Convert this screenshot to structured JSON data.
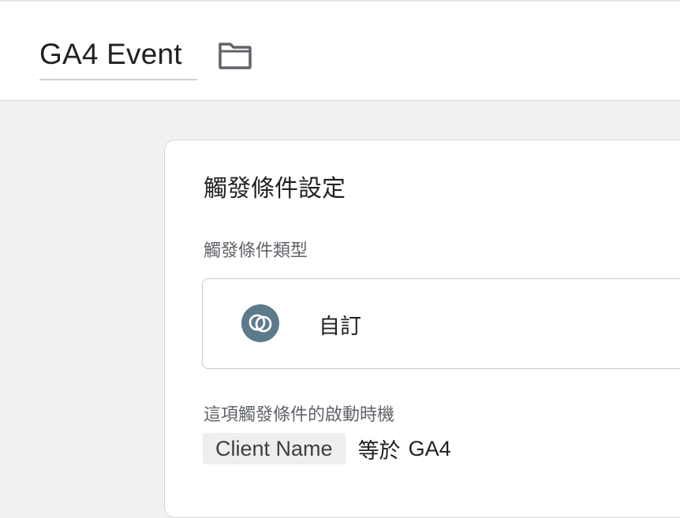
{
  "header": {
    "title": "GA4 Event",
    "folder_icon": "folder-icon"
  },
  "trigger_config": {
    "heading": "觸發條件設定",
    "type_label": "觸發條件類型",
    "type": {
      "icon": "custom-event-icon",
      "icon_color": "#5b7a8c",
      "name": "自訂"
    },
    "fires_on_label": "這項觸發條件的啟動時機",
    "condition": {
      "variable": "Client Name",
      "operator": "等於",
      "value": "GA4"
    }
  }
}
